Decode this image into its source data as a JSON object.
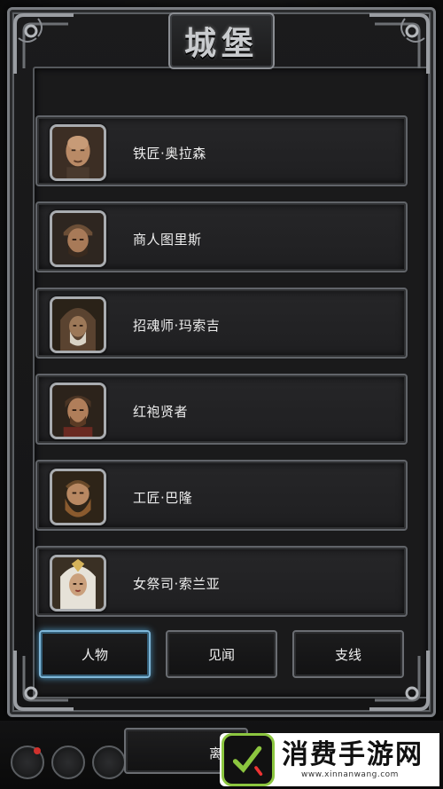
{
  "header": {
    "title": "城堡"
  },
  "npcs": [
    {
      "name": "铁匠·奥拉森",
      "portrait": "bald-man-portrait"
    },
    {
      "name": "商人图里斯",
      "portrait": "turban-merchant-portrait"
    },
    {
      "name": "招魂师·玛索吉",
      "portrait": "hooded-elder-portrait"
    },
    {
      "name": "红袍贤者",
      "portrait": "bearded-sage-portrait"
    },
    {
      "name": "工匠·巴隆",
      "portrait": "dwarf-craftsman-portrait"
    },
    {
      "name": "女祭司·索兰亚",
      "portrait": "priestess-portrait"
    }
  ],
  "tabs": [
    {
      "label": "人物",
      "active": true
    },
    {
      "label": "见闻",
      "active": false
    },
    {
      "label": "支线",
      "active": false
    }
  ],
  "bottom": {
    "leave_label": "离"
  },
  "watermark": {
    "title": "消费手游网",
    "url": "www.xinnanwang.com"
  },
  "colors": {
    "active_tab": "#7fb7d9",
    "notification": "#d0312d",
    "watermark_green": "#8cc63f"
  }
}
